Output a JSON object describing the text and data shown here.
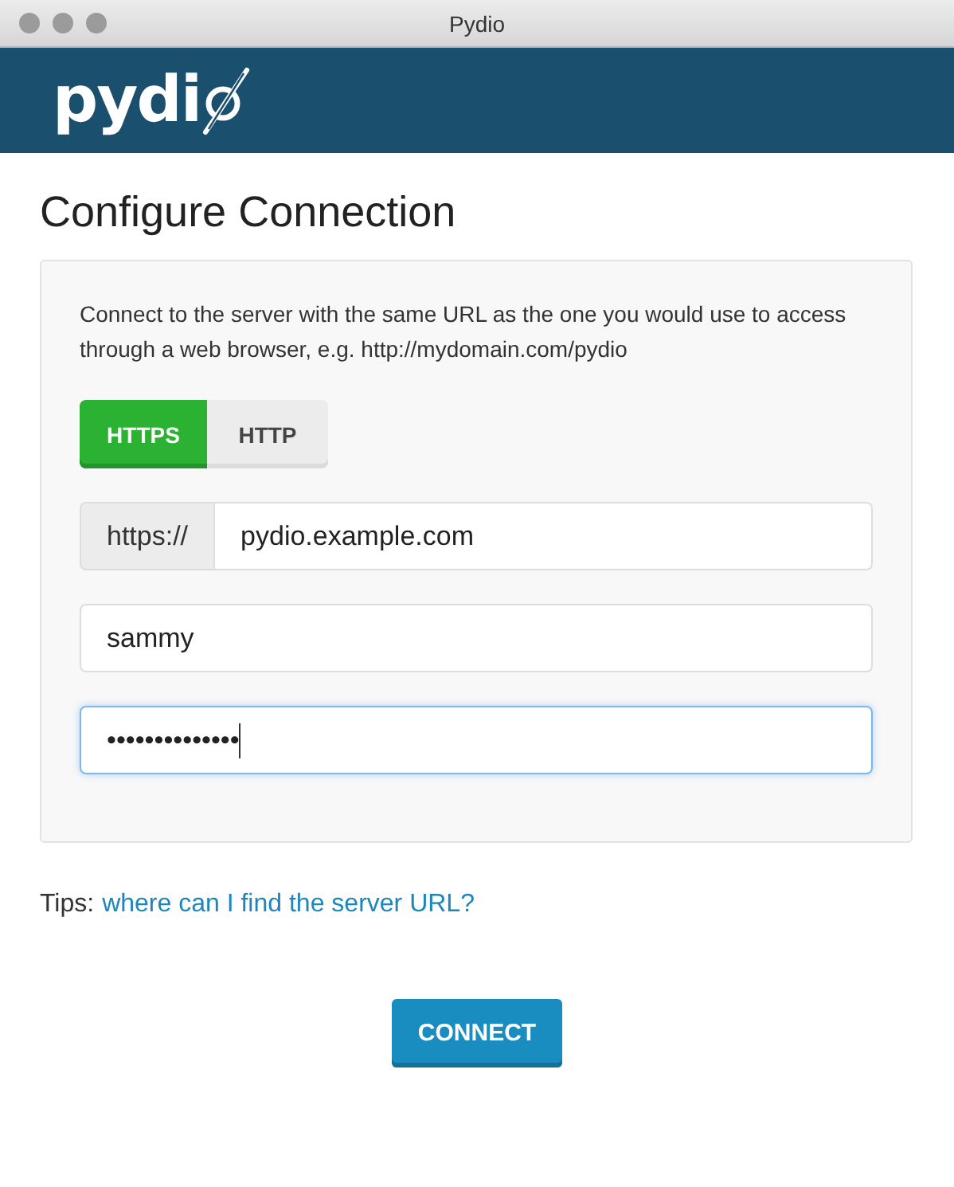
{
  "window": {
    "title": "Pydio"
  },
  "header": {
    "logo_text": "pydi"
  },
  "heading": "Configure Connection",
  "panel": {
    "description": "Connect to the server with the same URL as the one you would use to access through a web browser, e.g. http://mydomain.com/pydio",
    "protocols": [
      {
        "label": "HTTPS",
        "selected": true
      },
      {
        "label": "HTTP",
        "selected": false
      }
    ],
    "url_prefix": "https://",
    "fields": [
      {
        "kind": "url",
        "value": "pydio.example.com",
        "focused": false
      },
      {
        "kind": "text",
        "value": "sammy",
        "focused": false
      },
      {
        "kind": "password",
        "value": "••••••••••••••",
        "focused": true
      }
    ]
  },
  "tips": {
    "label": "Tips:",
    "link": "where can I find the server URL?"
  },
  "connect_button": "CONNECT"
}
